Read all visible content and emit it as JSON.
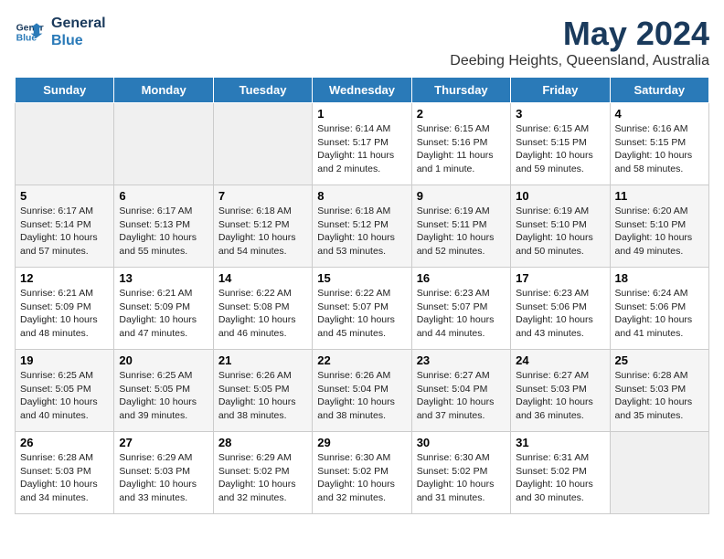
{
  "header": {
    "logo_line1": "General",
    "logo_line2": "Blue",
    "main_title": "May 2024",
    "subtitle": "Deebing Heights, Queensland, Australia"
  },
  "days_of_week": [
    "Sunday",
    "Monday",
    "Tuesday",
    "Wednesday",
    "Thursday",
    "Friday",
    "Saturday"
  ],
  "weeks": [
    [
      {
        "date": "",
        "info": ""
      },
      {
        "date": "",
        "info": ""
      },
      {
        "date": "",
        "info": ""
      },
      {
        "date": "1",
        "info": "Sunrise: 6:14 AM\nSunset: 5:17 PM\nDaylight: 11 hours\nand 2 minutes."
      },
      {
        "date": "2",
        "info": "Sunrise: 6:15 AM\nSunset: 5:16 PM\nDaylight: 11 hours\nand 1 minute."
      },
      {
        "date": "3",
        "info": "Sunrise: 6:15 AM\nSunset: 5:15 PM\nDaylight: 10 hours\nand 59 minutes."
      },
      {
        "date": "4",
        "info": "Sunrise: 6:16 AM\nSunset: 5:15 PM\nDaylight: 10 hours\nand 58 minutes."
      }
    ],
    [
      {
        "date": "5",
        "info": "Sunrise: 6:17 AM\nSunset: 5:14 PM\nDaylight: 10 hours\nand 57 minutes."
      },
      {
        "date": "6",
        "info": "Sunrise: 6:17 AM\nSunset: 5:13 PM\nDaylight: 10 hours\nand 55 minutes."
      },
      {
        "date": "7",
        "info": "Sunrise: 6:18 AM\nSunset: 5:12 PM\nDaylight: 10 hours\nand 54 minutes."
      },
      {
        "date": "8",
        "info": "Sunrise: 6:18 AM\nSunset: 5:12 PM\nDaylight: 10 hours\nand 53 minutes."
      },
      {
        "date": "9",
        "info": "Sunrise: 6:19 AM\nSunset: 5:11 PM\nDaylight: 10 hours\nand 52 minutes."
      },
      {
        "date": "10",
        "info": "Sunrise: 6:19 AM\nSunset: 5:10 PM\nDaylight: 10 hours\nand 50 minutes."
      },
      {
        "date": "11",
        "info": "Sunrise: 6:20 AM\nSunset: 5:10 PM\nDaylight: 10 hours\nand 49 minutes."
      }
    ],
    [
      {
        "date": "12",
        "info": "Sunrise: 6:21 AM\nSunset: 5:09 PM\nDaylight: 10 hours\nand 48 minutes."
      },
      {
        "date": "13",
        "info": "Sunrise: 6:21 AM\nSunset: 5:09 PM\nDaylight: 10 hours\nand 47 minutes."
      },
      {
        "date": "14",
        "info": "Sunrise: 6:22 AM\nSunset: 5:08 PM\nDaylight: 10 hours\nand 46 minutes."
      },
      {
        "date": "15",
        "info": "Sunrise: 6:22 AM\nSunset: 5:07 PM\nDaylight: 10 hours\nand 45 minutes."
      },
      {
        "date": "16",
        "info": "Sunrise: 6:23 AM\nSunset: 5:07 PM\nDaylight: 10 hours\nand 44 minutes."
      },
      {
        "date": "17",
        "info": "Sunrise: 6:23 AM\nSunset: 5:06 PM\nDaylight: 10 hours\nand 43 minutes."
      },
      {
        "date": "18",
        "info": "Sunrise: 6:24 AM\nSunset: 5:06 PM\nDaylight: 10 hours\nand 41 minutes."
      }
    ],
    [
      {
        "date": "19",
        "info": "Sunrise: 6:25 AM\nSunset: 5:05 PM\nDaylight: 10 hours\nand 40 minutes."
      },
      {
        "date": "20",
        "info": "Sunrise: 6:25 AM\nSunset: 5:05 PM\nDaylight: 10 hours\nand 39 minutes."
      },
      {
        "date": "21",
        "info": "Sunrise: 6:26 AM\nSunset: 5:05 PM\nDaylight: 10 hours\nand 38 minutes."
      },
      {
        "date": "22",
        "info": "Sunrise: 6:26 AM\nSunset: 5:04 PM\nDaylight: 10 hours\nand 38 minutes."
      },
      {
        "date": "23",
        "info": "Sunrise: 6:27 AM\nSunset: 5:04 PM\nDaylight: 10 hours\nand 37 minutes."
      },
      {
        "date": "24",
        "info": "Sunrise: 6:27 AM\nSunset: 5:03 PM\nDaylight: 10 hours\nand 36 minutes."
      },
      {
        "date": "25",
        "info": "Sunrise: 6:28 AM\nSunset: 5:03 PM\nDaylight: 10 hours\nand 35 minutes."
      }
    ],
    [
      {
        "date": "26",
        "info": "Sunrise: 6:28 AM\nSunset: 5:03 PM\nDaylight: 10 hours\nand 34 minutes."
      },
      {
        "date": "27",
        "info": "Sunrise: 6:29 AM\nSunset: 5:03 PM\nDaylight: 10 hours\nand 33 minutes."
      },
      {
        "date": "28",
        "info": "Sunrise: 6:29 AM\nSunset: 5:02 PM\nDaylight: 10 hours\nand 32 minutes."
      },
      {
        "date": "29",
        "info": "Sunrise: 6:30 AM\nSunset: 5:02 PM\nDaylight: 10 hours\nand 32 minutes."
      },
      {
        "date": "30",
        "info": "Sunrise: 6:30 AM\nSunset: 5:02 PM\nDaylight: 10 hours\nand 31 minutes."
      },
      {
        "date": "31",
        "info": "Sunrise: 6:31 AM\nSunset: 5:02 PM\nDaylight: 10 hours\nand 30 minutes."
      },
      {
        "date": "",
        "info": ""
      }
    ]
  ]
}
